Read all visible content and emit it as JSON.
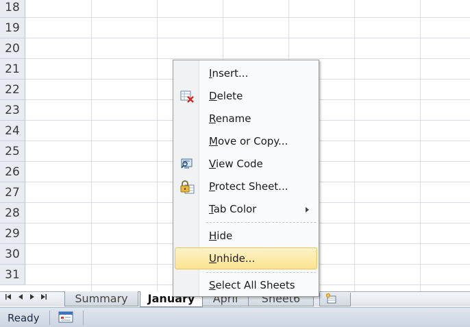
{
  "grid": {
    "rows": [
      "18",
      "19",
      "20",
      "21",
      "22",
      "23",
      "24",
      "25",
      "26",
      "27",
      "28",
      "29",
      "30",
      "31"
    ]
  },
  "sheet_tabs": {
    "nav": [
      "first-sheet",
      "prev-sheet",
      "next-sheet",
      "last-sheet"
    ],
    "tabs": [
      {
        "label": "Summary",
        "active": false
      },
      {
        "label": "January",
        "active": true
      },
      {
        "label": "April",
        "active": false
      },
      {
        "label": "Sheet6",
        "active": false
      }
    ],
    "new_sheet_icon": "insert-worksheet-icon"
  },
  "status_bar": {
    "status": "Ready",
    "macro_icon": "record-macro-icon"
  },
  "context_menu": {
    "items": [
      {
        "key": "I",
        "label": "nsert...",
        "icon": null
      },
      {
        "key": "D",
        "label": "elete",
        "icon": "delete-sheet-icon"
      },
      {
        "key": "R",
        "label": "ename",
        "icon": null
      },
      {
        "key": "M",
        "label": "ove or Copy...",
        "icon": null
      },
      {
        "key": "V",
        "label": "iew Code",
        "icon": "view-code-icon"
      },
      {
        "key": "P",
        "label": "rotect Sheet...",
        "icon": "protect-sheet-icon"
      },
      {
        "key": "T",
        "label": "ab Color",
        "icon": null,
        "submenu": true
      },
      {
        "key": "H",
        "label": "ide",
        "icon": null
      },
      {
        "key": "U",
        "label": "nhide...",
        "icon": null,
        "highlighted": true
      },
      {
        "key": "S",
        "label": "elect All Sheets",
        "icon": null
      }
    ]
  },
  "colors": {
    "menu_highlight": "#fbe38f",
    "grid_line": "#d9dde3",
    "header_bg": "#e9edf3"
  }
}
